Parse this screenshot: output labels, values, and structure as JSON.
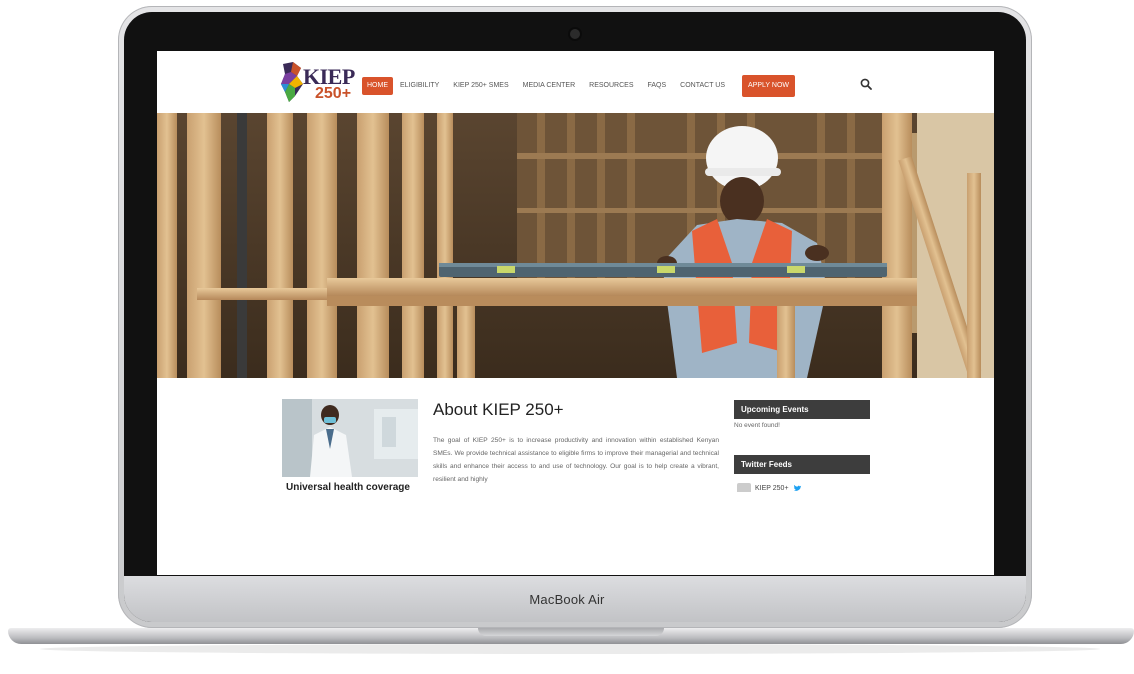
{
  "device": {
    "model_label": "MacBook Air"
  },
  "site": {
    "logo": {
      "kiep": "KIEP",
      "num": "250+"
    },
    "nav": {
      "items": [
        {
          "label": "HOME",
          "active": true
        },
        {
          "label": "ELIGIBILITY"
        },
        {
          "label": "KIEP 250+ SMEs"
        },
        {
          "label": "MEDIA CENTER"
        },
        {
          "label": "RESOURCES"
        },
        {
          "label": "FAQS"
        },
        {
          "label": "CONTACT US"
        }
      ],
      "apply_label": "APPLY NOW",
      "search_icon": "search-icon"
    },
    "hero": {
      "image": "construction worker in hard hat and orange safety vest holding a spirit level on timber framing"
    },
    "news": {
      "caption": "Universal health coverage"
    },
    "about": {
      "title": "About KIEP 250+",
      "text": "The goal of KIEP 250+ is to increase productivity and innovation within established Kenyan SMEs. We provide technical assistance to eligible firms to improve their managerial and technical skills and enhance their access to and use of technology. Our goal is to help create a vibrant, resilient and highly"
    },
    "sidebar": {
      "events_title": "Upcoming Events",
      "events_empty": "No event found!",
      "twitter_title": "Twitter Feeds",
      "tweet_user": "KIEP 250+"
    },
    "colors": {
      "accent": "#d9532b",
      "widget_bg": "#3d3d3d",
      "brand_purple": "#3a2a57"
    }
  }
}
